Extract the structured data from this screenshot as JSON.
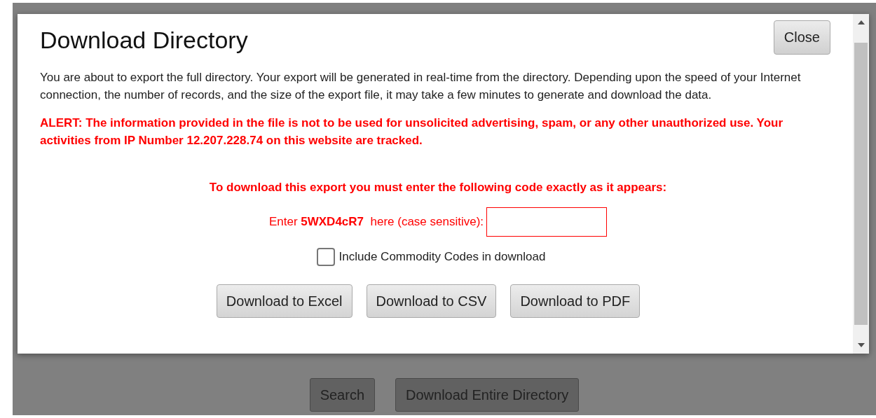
{
  "dialog": {
    "title": "Download Directory",
    "close_button": "Close",
    "description": "You are about to export the full directory. Your export will be generated in real-time from the directory. Depending upon the speed of your Internet connection, the number of records, and the size of the export file, it may take a few minutes to generate and download the data.",
    "alert": "ALERT: The information provided in the file is not to be used for unsolicited advertising, spam, or any other unauthorized use. Your activities from IP Number 12.207.228.74 on this website are tracked.",
    "instruction": "To download this export you must enter the following code exactly as it appears:",
    "code_prompt": "Enter **5WXD4cR7**  here (case sensitive):",
    "commodity_checkbox": {
      "label": "Include Commodity Codes in download",
      "checked": false
    },
    "buttons": [
      "Download to Excel",
      "Download to CSV",
      "Download to PDF"
    ]
  },
  "page_buttons": [
    "Search",
    "Download Entire Directory"
  ]
}
